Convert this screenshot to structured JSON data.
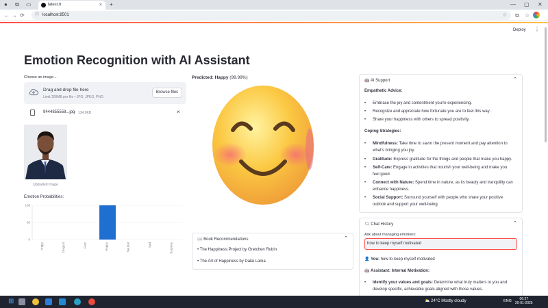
{
  "browser": {
    "tab_title": "latest.tr",
    "tab_close": "×",
    "new_tab": "+",
    "url": "localhost:8501",
    "back": "←",
    "forward": "→",
    "reload": "⟳"
  },
  "header": {
    "deploy_label": "Deploy",
    "menu_icon": "⋮"
  },
  "page": {
    "title": "Emotion Recognition with AI Assistant"
  },
  "uploader": {
    "label": "Choose an image...",
    "drag_text": "Drag and drop file here",
    "limit_text": "Limit 200MB per file • JPG, JPEG, PNG",
    "browse_label": "Browse files",
    "file_name": "9444855558...jpg",
    "file_size": "134.0KB",
    "remove": "×"
  },
  "image": {
    "caption": "Uploaded Image"
  },
  "prediction": {
    "label": "Predicted:",
    "value": "Happy",
    "confidence": "(99.99%)"
  },
  "probabilities": {
    "label": "Emotion Probabilities:"
  },
  "chart_data": {
    "type": "bar",
    "categories": [
      "Angry",
      "Disgust",
      "Fear",
      "Happy",
      "Neutral",
      "Sad",
      "Surprise"
    ],
    "values": [
      0,
      0,
      0,
      99.99,
      0,
      0,
      0
    ],
    "title": "",
    "xlabel": "",
    "ylabel": "",
    "ylim": [
      0,
      100
    ],
    "yticks": [
      "100",
      "50",
      "0"
    ],
    "color": "#1f6fd0"
  },
  "books": {
    "header": "Book Recommendations",
    "items": [
      "• The Happiness Project by Gretchen Rubin",
      "• The Art of Happiness by Dalai Lama"
    ]
  },
  "ai_support": {
    "header": "AI Support",
    "empathetic_title": "Empathetic Advice:",
    "empathetic": [
      "Embrace the joy and contentment you're experiencing.",
      "Recognize and appreciate how fortunate you are to feel this way.",
      "Share your happiness with others to spread positivity."
    ],
    "coping_title": "Coping Strategies:",
    "coping": [
      {
        "name": "Mindfulness:",
        "line1": "Take time to savor the present moment and pay attention to",
        "line2": "what's bringing you joy."
      },
      {
        "name": "Gratitude:",
        "line1": "Express gratitude for the things and people that make you happy.",
        "line2": ""
      },
      {
        "name": "Self-Care:",
        "line1": "Engage in activities that nourish your well-being and make you",
        "line2": "feel good."
      },
      {
        "name": "Connect with Nature:",
        "line1": "Spend time in nature, as its beauty and tranquility can",
        "line2": "enhance happiness."
      },
      {
        "name": "Social Support:",
        "line1": "Surround yourself with people who share your positive",
        "line2": "outlook and support your well-being."
      }
    ]
  },
  "chat": {
    "header": "Chat History",
    "ask_label": "Ask about managing emotions:",
    "input_value": "how to keep myself motivated",
    "you_label": "You:",
    "you_text": "how to keep myself motivated",
    "assistant_label": "Assistant: Internal Motivation:",
    "item_name": "Identify your values and goals:",
    "item_line1": "Determine what truly matters to you and",
    "item_line2": "develop specific, achievable goals aligned with those values."
  },
  "taskbar": {
    "weather_temp": "24°C",
    "weather_text": "Mostly cloudy",
    "lang": "ENG",
    "time": "06:27",
    "date": "20-01-2025"
  }
}
